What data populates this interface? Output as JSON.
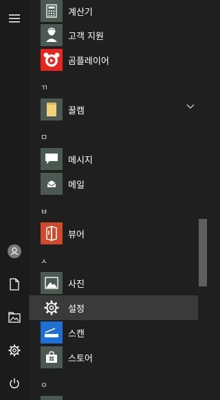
{
  "rail": {
    "menu_icon": "hamburger-menu-icon",
    "user_icon": "user-avatar-icon",
    "docs_icon": "document-icon",
    "pictures_icon": "pictures-folder-icon",
    "settings_icon": "gear-icon",
    "power_icon": "power-icon"
  },
  "apps": {
    "calculator": "계산기",
    "support": "고객 지원",
    "gomplayer": "곰플레이어",
    "header_kk": "ㄲ",
    "kkulcam": "꿀캠",
    "header_m": "ㅁ",
    "messaging": "메시지",
    "mail": "메일",
    "header_b": "ㅂ",
    "viewer": "뷰어",
    "header_s": "ㅅ",
    "photos": "사진",
    "settings": "설정",
    "scan": "스캔",
    "store": "스토어",
    "header_o": "ㅇ"
  },
  "colors": {
    "tile_gray": "#4a5a53",
    "tile_red": "#d04a2a",
    "tile_blue": "#1e6fd6",
    "gom_red": "#e8261e"
  }
}
